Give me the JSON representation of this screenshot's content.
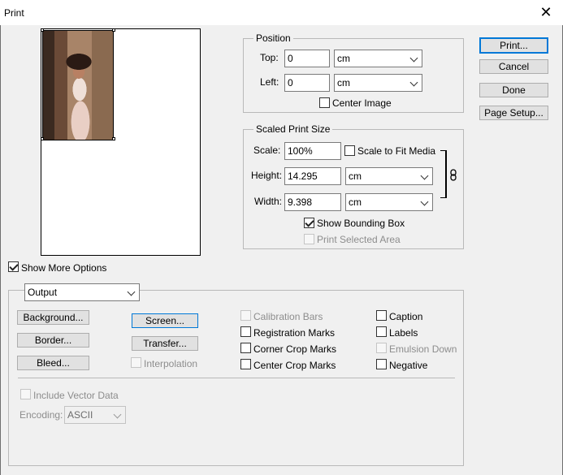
{
  "window": {
    "title": "Print",
    "close_glyph": "✕"
  },
  "position": {
    "legend": "Position",
    "top_label": "Top:",
    "top_value": "0",
    "top_unit": "cm",
    "left_label": "Left:",
    "left_value": "0",
    "left_unit": "cm",
    "center_image_label": "Center Image",
    "center_image_checked": false
  },
  "scaled": {
    "legend": "Scaled Print Size",
    "scale_label": "Scale:",
    "scale_value": "100%",
    "scale_to_fit_label": "Scale to Fit Media",
    "scale_to_fit_checked": false,
    "height_label": "Height:",
    "height_value": "14.295",
    "height_unit": "cm",
    "width_label": "Width:",
    "width_value": "9.398",
    "width_unit": "cm",
    "show_bbox_label": "Show Bounding Box",
    "show_bbox_checked": true,
    "print_selected_label": "Print Selected Area",
    "print_selected_checked": false
  },
  "buttons": {
    "print": "Print...",
    "cancel": "Cancel",
    "done": "Done",
    "page_setup": "Page Setup..."
  },
  "more_options": {
    "label": "Show More Options",
    "checked": true
  },
  "output": {
    "dropdown": "Output",
    "background": "Background...",
    "border": "Border...",
    "bleed": "Bleed...",
    "screen": "Screen...",
    "transfer": "Transfer...",
    "interpolation": "Interpolation",
    "calibration_bars": "Calibration Bars",
    "registration_marks": "Registration Marks",
    "corner_crop_marks": "Corner Crop Marks",
    "center_crop_marks": "Center Crop Marks",
    "caption": "Caption",
    "labels": "Labels",
    "emulsion_down": "Emulsion Down",
    "negative": "Negative",
    "include_vector": "Include Vector Data",
    "encoding_label": "Encoding:",
    "encoding_value": "ASCII"
  },
  "icons": {
    "link": "chain-link-icon"
  }
}
